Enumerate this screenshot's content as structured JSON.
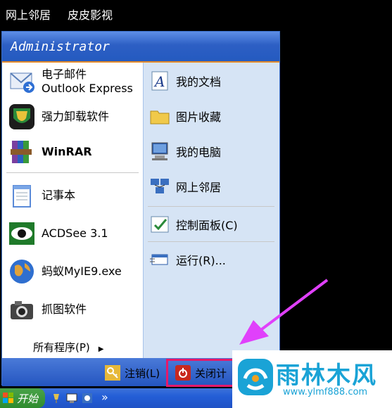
{
  "desktop": {
    "icon_labels": [
      "网上邻居",
      "皮皮影视"
    ]
  },
  "start_menu": {
    "user_name": "Administrator",
    "pinned": [
      {
        "title": "电子邮件",
        "subtitle": "Outlook Express",
        "icon": "mail-icon"
      },
      {
        "title": "强力卸载软件",
        "icon": "uninstaller-icon"
      },
      {
        "title": "WinRAR",
        "icon": "winrar-icon"
      }
    ],
    "recent": [
      {
        "title": "记事本",
        "icon": "notepad-icon"
      },
      {
        "title": "ACDSee 3.1",
        "icon": "acdsee-icon"
      },
      {
        "title": "蚂蚁MyIE9.exe",
        "icon": "globe-icon"
      },
      {
        "title": "抓图软件",
        "icon": "camera-icon"
      }
    ],
    "all_programs_label": "所有程序(P)",
    "places": [
      {
        "title": "我的文档",
        "icon": "documents-icon"
      },
      {
        "title": "图片收藏",
        "icon": "folder-icon"
      },
      {
        "title": "我的电脑",
        "icon": "computer-icon"
      },
      {
        "title": "网上邻居",
        "icon": "network-icon"
      },
      {
        "title": "控制面板(C)",
        "icon": "control-panel-icon"
      },
      {
        "title": "运行(R)...",
        "icon": "run-icon"
      }
    ],
    "footer": {
      "logoff_label": "注销(L)",
      "shutdown_label": "关闭计"
    }
  },
  "taskbar": {
    "start_label": "开始",
    "overflow": "»"
  },
  "watermark": {
    "brand": "雨林木风",
    "url": "www.ylmf888.com"
  },
  "colors": {
    "header_blue": "#2d5fc4",
    "highlight": "#e6196a",
    "arrow": "#e040fb",
    "watermark": "#1aa3d6"
  }
}
